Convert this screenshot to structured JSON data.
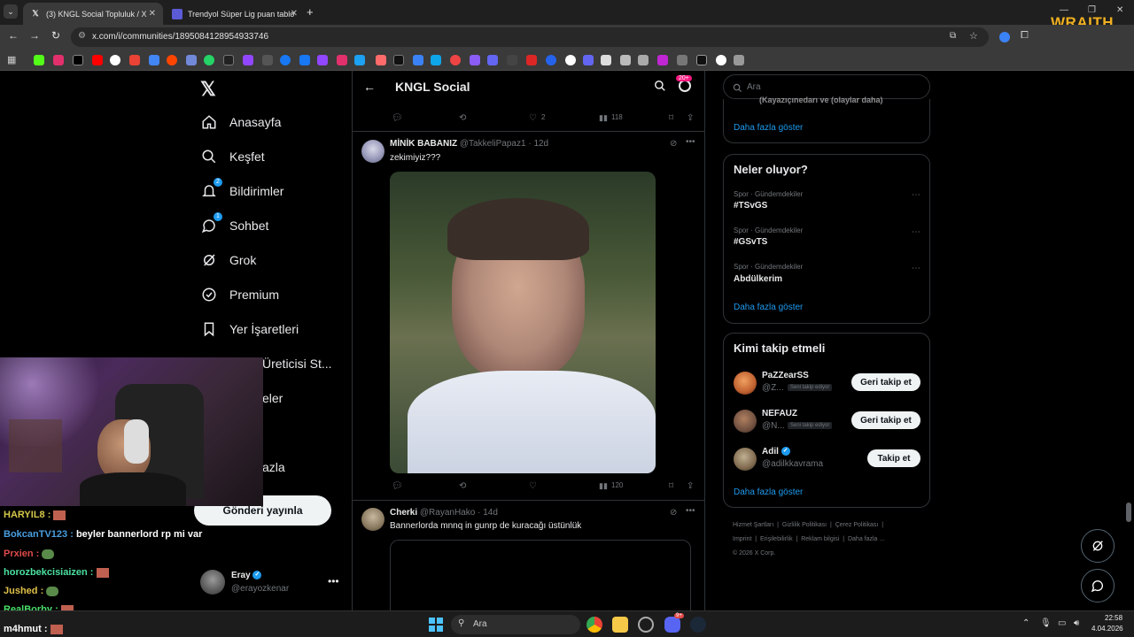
{
  "browser": {
    "tabs": [
      {
        "label": "(3) KNGL Social Topluluk / X",
        "active": true
      },
      {
        "label": "Trendyol Süper Lig puan tablosu",
        "active": false
      }
    ],
    "url": "x.com/i/communities/1895084128954933746",
    "wraith_logo": "WRAITH"
  },
  "left_nav": {
    "items": [
      {
        "label": "Anasayfa",
        "icon": "home-icon"
      },
      {
        "label": "Keşfet",
        "icon": "search-icon"
      },
      {
        "label": "Bildirimler",
        "icon": "bell-icon",
        "badge": "2"
      },
      {
        "label": "Sohbet",
        "icon": "chat-icon",
        "badge": "1"
      },
      {
        "label": "Grok",
        "icon": "grok-icon"
      },
      {
        "label": "Premium",
        "icon": "premium-icon"
      },
      {
        "label": "Yer İşaretleri",
        "icon": "bookmark-icon"
      },
      {
        "label": "Üreticisi St...",
        "icon": "creator-icon"
      },
      {
        "label": "eler",
        "icon": "communities-icon"
      },
      {
        "label": "azla",
        "icon": "more-icon"
      }
    ],
    "post_button": "Gönderi yayınla",
    "profile": {
      "name": "Eray",
      "handle": "@erayozkenar"
    }
  },
  "center": {
    "header_title": "KNGL Social",
    "header_badge": "20+",
    "top_actions": {
      "likes": "2",
      "views": "118"
    },
    "tweets": [
      {
        "name": "MİNİK BABANIZ",
        "handle": "@TakkeliPapaz1",
        "time": "12d",
        "text": "zekimiyiz???",
        "views": "120"
      },
      {
        "name": "Cherki",
        "handle": "@RayanHako",
        "time": "14d",
        "text": "Bannerlorda mnnq in gunrp de kuracağı üstünlük"
      }
    ]
  },
  "right": {
    "search_placeholder": "Ara",
    "top_cut_text": "(Kayazıçınedarı ve (olaylar daha)",
    "top_show_more": "Daha fazla göster",
    "trends_title": "Neler oluyor?",
    "trends": [
      {
        "meta": "Spor · Gündemdekiler",
        "name": "#TSvGS"
      },
      {
        "meta": "Spor · Gündemdekiler",
        "name": "#GSvTS"
      },
      {
        "meta": "Spor · Gündemdekiler",
        "name": "Abdülkerim"
      }
    ],
    "trends_show_more": "Daha fazla göster",
    "follow_title": "Kimi takip etmeli",
    "suggestions": [
      {
        "name": "PaZZearSS",
        "handle": "@Z...",
        "badge": "Seni takip ediyor",
        "button": "Geri takip et"
      },
      {
        "name": "NEFAUZ",
        "handle": "@N...",
        "badge": "Seni takip ediyor",
        "button": "Geri takip et"
      },
      {
        "name": "Adil",
        "handle": "@adilkkavrama",
        "badge": "",
        "button": "Takip et"
      }
    ],
    "follow_show_more": "Daha fazla göster",
    "footer": {
      "line1": [
        "Hizmet Şartları",
        "Gizlilik Politikası",
        "Çerez Politikası"
      ],
      "line2": [
        "Imprint",
        "Erişilebilirlik",
        "Reklam bilgisi",
        "Daha fazla ..."
      ],
      "copyright": "© 2026 X Corp."
    }
  },
  "chat": [
    {
      "name": "HARYIL8 :",
      "msg": "",
      "color": "#d4c84a"
    },
    {
      "name": "BokcanTV123 :",
      "msg": "beyler bannerlord rp mi var",
      "color": "#4a9ee0"
    },
    {
      "name": "Prxien :",
      "msg": "",
      "color": "#e04a4a"
    },
    {
      "name": "horozbekcisiaizen :",
      "msg": "",
      "color": "#4ae0a0"
    },
    {
      "name": "Jushed :",
      "msg": "",
      "color": "#e0c04a"
    },
    {
      "name": "RealBorby :",
      "msg": "",
      "color": "#4ae06a"
    },
    {
      "name": "m4hmut :",
      "msg": "",
      "color": "#ffffff"
    }
  ],
  "taskbar": {
    "search": "Ara",
    "time": "22:58",
    "date": "4.04.2026",
    "discord_badge": "9+"
  }
}
